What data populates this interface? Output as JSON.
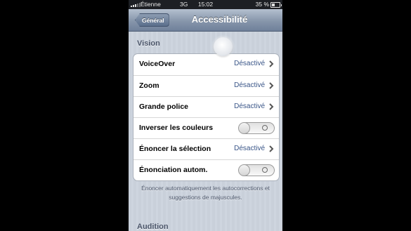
{
  "status_bar": {
    "carrier": "Étienne",
    "network": "3G",
    "time": "15:02",
    "battery": "35 %",
    "battery_level": 0.35
  },
  "nav": {
    "back_label": "Général",
    "title": "Accessibilité"
  },
  "sections": {
    "vision": "Vision",
    "audition": "Audition"
  },
  "rows": [
    {
      "label": "VoiceOver",
      "value": "Désactivé",
      "kind": "disclosure"
    },
    {
      "label": "Zoom",
      "value": "Désactivé",
      "kind": "disclosure"
    },
    {
      "label": "Grande police",
      "value": "Désactivé",
      "kind": "disclosure"
    },
    {
      "label": "Inverser les couleurs",
      "kind": "toggle",
      "on": false
    },
    {
      "label": "Énoncer la sélection",
      "value": "Désactivé",
      "kind": "disclosure"
    },
    {
      "label": "Énonciation autom.",
      "kind": "toggle",
      "on": false
    }
  ],
  "footer_note": "Énoncer automatiquement les autocorrections et suggestions de majuscules.",
  "colors": {
    "nav_bar": "#8796ab",
    "value_text": "#385487",
    "background": "#cbd2dc"
  },
  "icons": {
    "back": "chevron-left-icon",
    "disclosure": "chevron-right-icon",
    "toggle_off": "toggle-off-icon"
  }
}
